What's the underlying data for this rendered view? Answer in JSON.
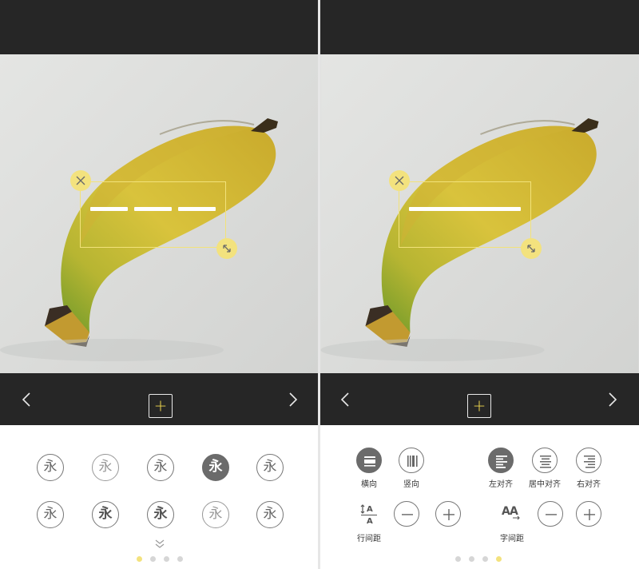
{
  "accent_color": "#f3e27e",
  "left_panel": {
    "add_button": {
      "icon": "plus-icon",
      "label": "+"
    },
    "prev_icon": "chevron-left-icon",
    "next_icon": "chevron-right-icon",
    "text_box": {
      "delete_icon": "close-icon",
      "resize_icon": "resize-icon",
      "placeholder_style": "three-dashes"
    },
    "font_styles": {
      "sample_glyph": "永",
      "rows": [
        [
          "永",
          "永",
          "永",
          "永",
          "永"
        ],
        [
          "永",
          "永",
          "永",
          "永",
          "永"
        ]
      ],
      "selected": "row1-col4"
    },
    "expand_icon": "double-chevron-down-icon",
    "pager": {
      "count": 4,
      "active": 1
    }
  },
  "right_panel": {
    "add_button": {
      "icon": "plus-icon",
      "label": "+"
    },
    "prev_icon": "chevron-left-icon",
    "next_icon": "chevron-right-icon",
    "text_box": {
      "delete_icon": "close-icon",
      "resize_icon": "resize-icon",
      "placeholder_style": "single-line"
    },
    "orientation": {
      "horizontal_label": "横向",
      "vertical_label": "竖向",
      "selected": "horizontal"
    },
    "alignment": {
      "left_label": "左对齐",
      "center_label": "居中对齐",
      "right_label": "右对齐",
      "selected": "left"
    },
    "line_spacing": {
      "label": "行间距",
      "minus": "−",
      "plus": "+"
    },
    "letter_spacing": {
      "label": "字间距",
      "minus": "−",
      "plus": "+"
    },
    "pager": {
      "count": 4,
      "active": 4
    }
  }
}
